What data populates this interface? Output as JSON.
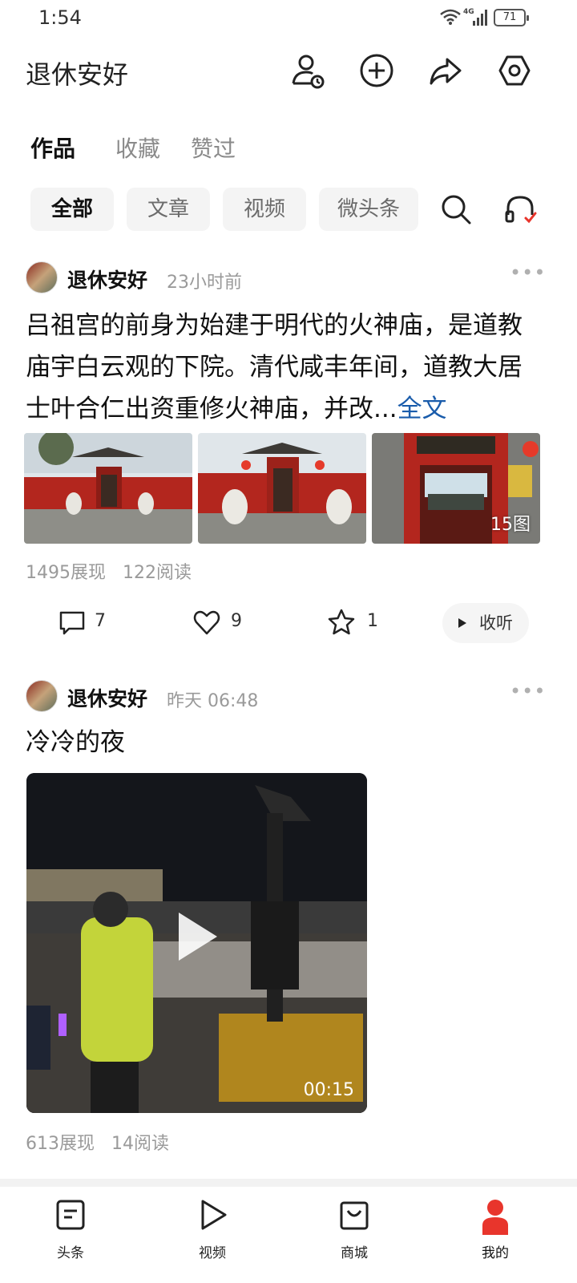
{
  "status_bar": {
    "time": "1:54",
    "network": "4G",
    "battery": "71"
  },
  "header": {
    "title": "退休安好"
  },
  "tabs": [
    {
      "label": "作品"
    },
    {
      "label": "收藏"
    },
    {
      "label": "赞过"
    }
  ],
  "filters": [
    {
      "label": "全部"
    },
    {
      "label": "文章"
    },
    {
      "label": "视频"
    },
    {
      "label": "微头条"
    }
  ],
  "posts": [
    {
      "author": "退休安好",
      "time": "23小时前",
      "text": "吕祖宫的前身为始建于明代的火神庙，是道教庙宇白云观的下院。清代咸丰年间，道教大居士叶合仁出资重修火神庙，并改...",
      "full_text_link": "全文",
      "image_count": "15图",
      "impressions": "1495展现",
      "reads": "122阅读",
      "comments": "7",
      "likes": "9",
      "favorites": "1",
      "listen_label": "收听"
    },
    {
      "author": "退休安好",
      "time": "昨天  06:48",
      "text": "冷冷的夜",
      "video_duration": "00:15",
      "impressions": "613展现",
      "reads": "14阅读"
    }
  ],
  "bottom_nav": [
    {
      "label": "头条"
    },
    {
      "label": "视频"
    },
    {
      "label": "商城"
    },
    {
      "label": "我的"
    }
  ],
  "colors": {
    "accent_red": "#e8352c",
    "link_blue": "#1a5cab",
    "temple_red": "#b3261e"
  }
}
